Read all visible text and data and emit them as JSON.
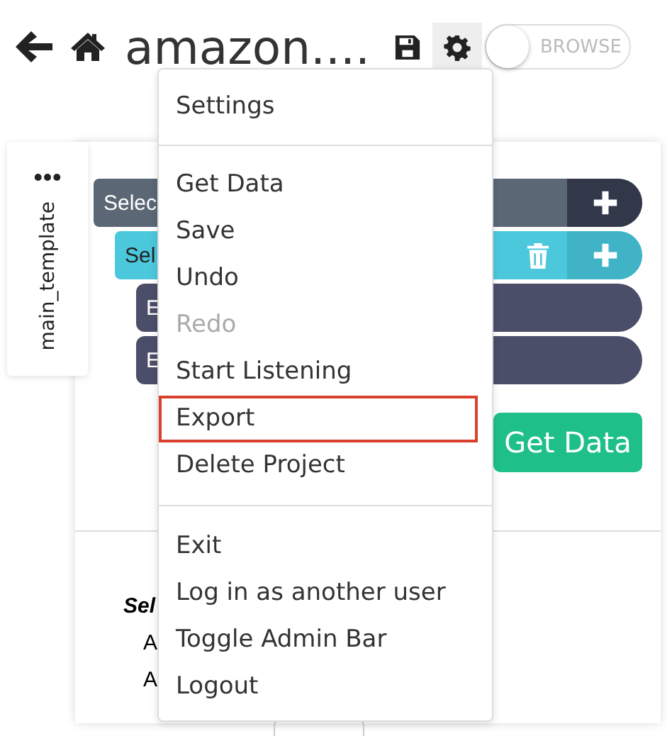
{
  "header": {
    "title": "amazon....",
    "toggle": {
      "label": "BROWSE",
      "on": false
    }
  },
  "side_tab": {
    "label": "main_template"
  },
  "nodes": [
    {
      "label": "Selec",
      "kind": "select",
      "selected": false,
      "children": [
        {
          "label": "Sel",
          "kind": "select",
          "selected": true,
          "children": [
            {
              "label": "E",
              "kind": "extract",
              "selected": false
            },
            {
              "label": "E",
              "kind": "extract",
              "selected": false
            }
          ]
        }
      ]
    }
  ],
  "action_button": "Get Data",
  "details": {
    "heading": "Sel",
    "lines": [
      "A",
      "A"
    ]
  },
  "menu": {
    "sections": [
      [
        {
          "label": "Settings",
          "disabled": false,
          "highlighted": false
        }
      ],
      [
        {
          "label": "Get Data",
          "disabled": false,
          "highlighted": false
        },
        {
          "label": "Save",
          "disabled": false,
          "highlighted": false
        },
        {
          "label": "Undo",
          "disabled": false,
          "highlighted": false
        },
        {
          "label": "Redo",
          "disabled": true,
          "highlighted": false
        },
        {
          "label": "Start Listening",
          "disabled": false,
          "highlighted": false
        },
        {
          "label": "Export",
          "disabled": false,
          "highlighted": true
        },
        {
          "label": "Delete Project",
          "disabled": false,
          "highlighted": false
        }
      ],
      [
        {
          "label": "Exit",
          "disabled": false,
          "highlighted": false
        },
        {
          "label": "Log in as another user",
          "disabled": false,
          "highlighted": false
        },
        {
          "label": "Toggle Admin Bar",
          "disabled": false,
          "highlighted": false
        },
        {
          "label": "Logout",
          "disabled": false,
          "highlighted": false
        }
      ]
    ]
  }
}
